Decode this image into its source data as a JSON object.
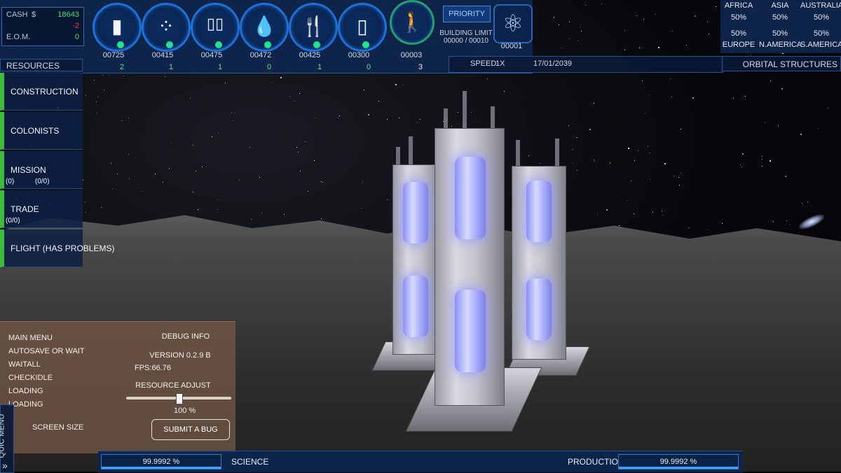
{
  "hud": {
    "cash_label": "CASH",
    "cash_symbol": "$",
    "cash_value": "18643",
    "cash_delta": "-2",
    "eom_label": "E.O.M.",
    "eom_value": "0",
    "resources": [
      {
        "icon": "battery-icon",
        "glyph": "▮",
        "amount": "00725",
        "change": "2"
      },
      {
        "icon": "ore-icon",
        "glyph": "⁘",
        "amount": "00415",
        "change": "1"
      },
      {
        "icon": "oxygen-tanks-icon",
        "glyph": "▯▯",
        "amount": "00475",
        "change": "1"
      },
      {
        "icon": "water-drop-icon",
        "glyph": "💧",
        "amount": "00472",
        "change": "0"
      },
      {
        "icon": "food-cutlery-icon",
        "glyph": "🍴",
        "amount": "00425",
        "change": "1"
      },
      {
        "icon": "fuel-canister-icon",
        "glyph": "▯",
        "amount": "00300",
        "change": "0"
      },
      {
        "icon": "colonist-icon",
        "glyph": "🚶",
        "amount": "00003",
        "change": "3"
      }
    ],
    "priority_label": "PRIORITY",
    "building_limit_label": "BUILDING LIMIT",
    "building_limit_value": "00000 / 00010",
    "science_icon": "atom-icon",
    "science_value": "00001",
    "speed_label": "SPEED",
    "speed_value": "1X",
    "date": "17/01/2039",
    "resources_tab": "RESOURCES",
    "orbital_structures": "ORBITAL STRUCTURES"
  },
  "regions": [
    {
      "name": "AFRICA",
      "pct": "50%"
    },
    {
      "name": "ASIA",
      "pct": "50%"
    },
    {
      "name": "AUSTRALIA",
      "pct": "50%"
    },
    {
      "name": "EUROPE",
      "pct": "50%"
    },
    {
      "name": "N.AMERICA",
      "pct": "50%"
    },
    {
      "name": "S.AMERICA",
      "pct": "50%"
    }
  ],
  "left_menu": [
    {
      "label": "CONSTRUCTION"
    },
    {
      "label": "COLONISTS"
    },
    {
      "label": "MISSION",
      "sub1": "(0)",
      "sub2": "(0/0)"
    },
    {
      "label": "TRADE",
      "sub1": "(0/0)"
    },
    {
      "label": "FLIGHT (HAS PROBLEMS)"
    }
  ],
  "debug": {
    "items": [
      "MAIN MENU",
      "AUTOSAVE OR WAIT",
      "WAITALL",
      "CHECKIDLE",
      "LOADING",
      "LOADING"
    ],
    "title": "DEBUG INFO",
    "version": "VERSION 0.2.9 B",
    "fps": "FPS:66.76",
    "resource_adjust": "RESOURCE ADJUST",
    "slider_value": "100",
    "slider_unit": "%",
    "slider_fraction": 0.5,
    "screen_size": "SCREEN SIZE",
    "submit_bug": "SUBMIT A BUG",
    "quick_menu": "QUIC MENU",
    "quick_arrows": "»"
  },
  "bottom": {
    "science_label": "SCIENCE",
    "science_pct": "99.9992 %",
    "production_label": "PRODUCTION",
    "production_pct": "99.9992 %",
    "progress_fraction": 0.999992
  }
}
